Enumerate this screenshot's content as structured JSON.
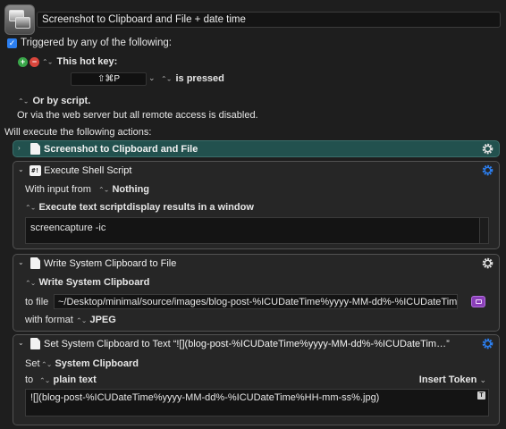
{
  "macro": {
    "title": "Screenshot to Clipboard and File + date time"
  },
  "trigger": {
    "triggered_label": "Triggered by any of the following:",
    "hotkey_label": "This hot key:",
    "hotkey_value": "⇧⌘P",
    "pressed_label": "is pressed",
    "or_script": "Or by script.",
    "web_server": "Or via the web server but all remote access is disabled."
  },
  "will_execute": "Will execute the following actions:",
  "actions": {
    "a1": {
      "title": "Screenshot to Clipboard and File"
    },
    "a2": {
      "title": "Execute Shell Script",
      "with_input_label": "With input from",
      "with_input_value": "Nothing",
      "execute_mode": "Execute text script",
      "display_mode": "display results in a window",
      "script": "screencapture -ic"
    },
    "a3": {
      "title": "Write System Clipboard to File",
      "source": "Write System Clipboard",
      "to_file_label": "to file",
      "file_path": "~/Desktop/minimal/source/images/blog-post-%ICUDateTime%yyyy-MM-dd%-%ICUDateTime%HH-r",
      "with_format_label": "with format",
      "format": "JPEG"
    },
    "a4": {
      "title": "Set System Clipboard to Text “![](blog-post-%ICUDateTime%yyyy-MM-dd%-%ICUDateTim…”",
      "set_label": "Set",
      "target": "System Clipboard",
      "to_label": "to",
      "text_mode": "plain text",
      "insert_token": "Insert Token",
      "text": "![](blog-post-%ICUDateTime%yyyy-MM-dd%-%ICUDateTime%HH-mm-ss%.jpg)"
    }
  },
  "colors": {
    "background": "#1e1e1e",
    "accent_blue": "#2c7ff0",
    "collapsed_action": "#22514e",
    "add_green": "#3aa64a",
    "remove_red": "#d9463c",
    "token_purple": "#8a3fb8"
  },
  "icons": {
    "macro": "screenshot-windows-icon",
    "gear": "gear-icon",
    "document": "document-icon",
    "terminal": "terminal-icon",
    "clipboard": "clipboard-text-icon"
  }
}
